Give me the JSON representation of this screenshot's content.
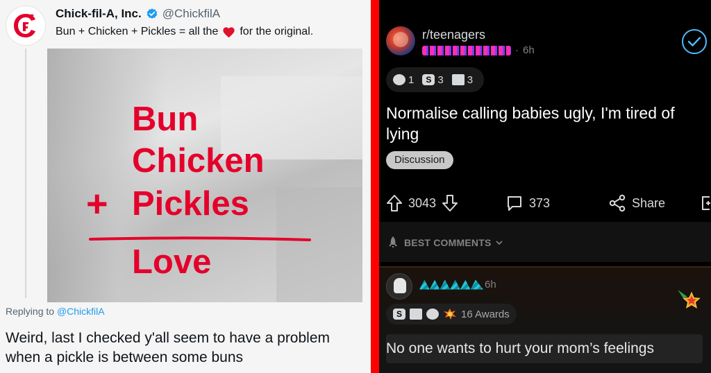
{
  "tweet": {
    "display_name": "Chick-fil-A, Inc.",
    "handle": "@ChickfilA",
    "text_before_heart": "Bun + Chicken + Pickles = all the",
    "text_after_heart": "for the original.",
    "image_text": {
      "line1": "Bun",
      "line2": "Chicken",
      "plus": "+",
      "line3": "Pickles",
      "line4": "Love"
    },
    "replying_label": "Replying to",
    "replying_handle": "@ChickfilA",
    "reply_text": "Weird, last I checked y'all seem to have a problem when a pickle is between some buns",
    "icons": [
      "chickfila-logo-icon",
      "verified-badge-icon",
      "heart-icon"
    ],
    "colors": {
      "brand_red": "#e4002b",
      "link_blue": "#1d9bf0",
      "verified_blue": "#1d9bf0"
    }
  },
  "reddit": {
    "subreddit": "r/teenagers",
    "post_age": "6h",
    "awards": [
      {
        "icon": "silver-award-icon",
        "count": "1"
      },
      {
        "icon": "helpful-award-icon",
        "count": "3"
      },
      {
        "icon": "wholesome-award-icon",
        "count": "3"
      }
    ],
    "title": "Normalise calling babies ugly, I'm tired of lying",
    "flair": "Discussion",
    "votes": "3043",
    "comments_count": "373",
    "share_label": "Share",
    "sort_label": "BEST COMMENTS",
    "comment": {
      "age": "6h",
      "awards_label": "16 Awards",
      "text": "No one wants to hurt your mom’s feelings"
    },
    "colors": {
      "background": "#000000",
      "accent_blue": "#4fbcff",
      "divider_red": "#ff0000"
    }
  }
}
